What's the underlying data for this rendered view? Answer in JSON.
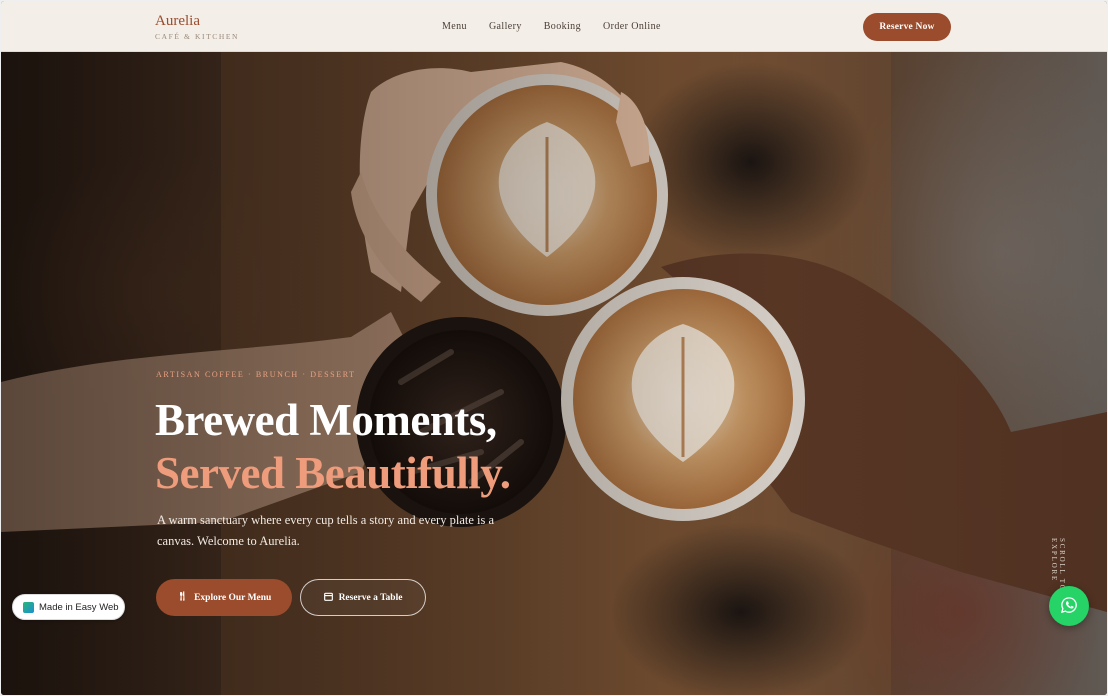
{
  "brand": {
    "name": "Aurelia",
    "tagline": "CAFÉ & KITCHEN"
  },
  "nav": {
    "links": [
      {
        "label": "Menu"
      },
      {
        "label": "Gallery"
      },
      {
        "label": "Booking"
      },
      {
        "label": "Order Online"
      }
    ],
    "cta_label": "Reserve Now"
  },
  "hero": {
    "eyebrow": "ARTISAN COFFEE · BRUNCH · DESSERT",
    "headline_line1": "Brewed Moments,",
    "headline_line2": "Served Beautifully.",
    "description": "A warm sanctuary where every cup tells a story and every plate is a canvas. Welcome to Aurelia.",
    "primary_cta": {
      "label": "Explore Our Menu",
      "icon": "utensils-icon"
    },
    "secondary_cta": {
      "label": "Reserve a Table",
      "icon": "calendar-icon"
    },
    "scroll_cue": "SCROLL TO EXPLORE"
  },
  "badge": {
    "label": "Made in Easy Web",
    "icon": "easyweb-logo-icon"
  },
  "floating": {
    "icon": "whatsapp-icon"
  },
  "colors": {
    "accent": "#9a4c2c",
    "highlight": "#ee9c7c",
    "nav_bg": "#f3eee8",
    "whatsapp": "#25d366"
  }
}
